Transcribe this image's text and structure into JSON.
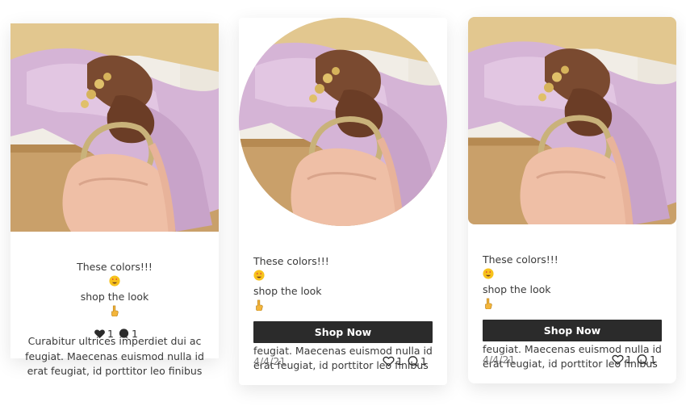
{
  "posts": [
    {
      "caption_pre": "These colors!!!",
      "caption_mid": "shop the look",
      "caption_rest": "Curabitur ultrices imperdiet dui ac feugiat. Maecenas euismod nulla id erat feugiat, id porttitor leo finibus",
      "likes": "1",
      "comments": "1"
    },
    {
      "caption_pre": "These colors!!!",
      "caption_mid": "shop the look",
      "caption_rest": "Curabitur ultrices imperdiet dui ac feugiat. Maecenas euismod nulla id erat feugiat, id porttitor leo finibus",
      "button_label": "Shop Now",
      "date": "4/4/21",
      "likes": "1",
      "comments": "1"
    },
    {
      "caption_pre": "These colors!!!",
      "caption_mid": "shop the look",
      "caption_rest": "Curabitur ultrices imperdiet dui ac feugiat. Maecenas euismod nulla id erat feugiat, id porttitor leo finibus",
      "button_label": "Shop Now",
      "date": "4/4/21",
      "likes": "1",
      "comments": "1"
    }
  ],
  "colors": {
    "button_bg": "#2b2b2b",
    "button_text": "#ffffff",
    "text": "#3a3a3a",
    "date": "#777777"
  },
  "icons": [
    "heart-icon",
    "comment-icon",
    "star-struck-emoji",
    "pointing-down-emoji"
  ]
}
